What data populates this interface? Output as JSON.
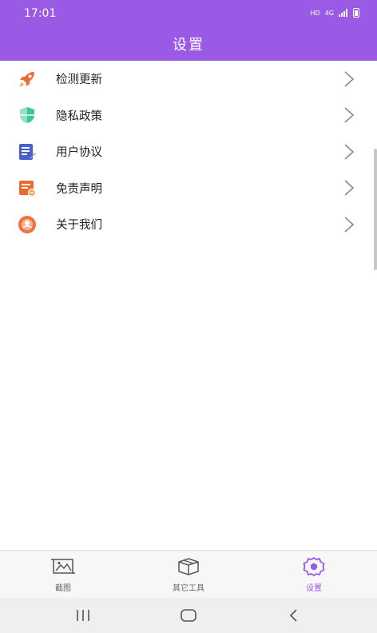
{
  "status_bar": {
    "time": "17:01",
    "hd": "HD",
    "network": "4G"
  },
  "header": {
    "title": "设置"
  },
  "menu": {
    "items": [
      {
        "label": "检测更新",
        "icon": "rocket-icon",
        "icon_color": "#f06a35"
      },
      {
        "label": "隐私政策",
        "icon": "shield-icon",
        "icon_color": "#3cc59a"
      },
      {
        "label": "用户协议",
        "icon": "document-icon",
        "icon_color": "#4a5fc8"
      },
      {
        "label": "免责声明",
        "icon": "notice-icon",
        "icon_color": "#ee6a2a"
      },
      {
        "label": "关于我们",
        "icon": "about-icon",
        "icon_color": "#ef7040"
      }
    ]
  },
  "tabbar": {
    "tabs": [
      {
        "label": "截图",
        "icon": "image-icon",
        "active": false
      },
      {
        "label": "其它工具",
        "icon": "box-icon",
        "active": false
      },
      {
        "label": "设置",
        "icon": "gear-icon",
        "active": true
      }
    ]
  },
  "colors": {
    "accent": "#9b5ae6",
    "text": "#222222",
    "chevron": "#8a8a8a"
  }
}
